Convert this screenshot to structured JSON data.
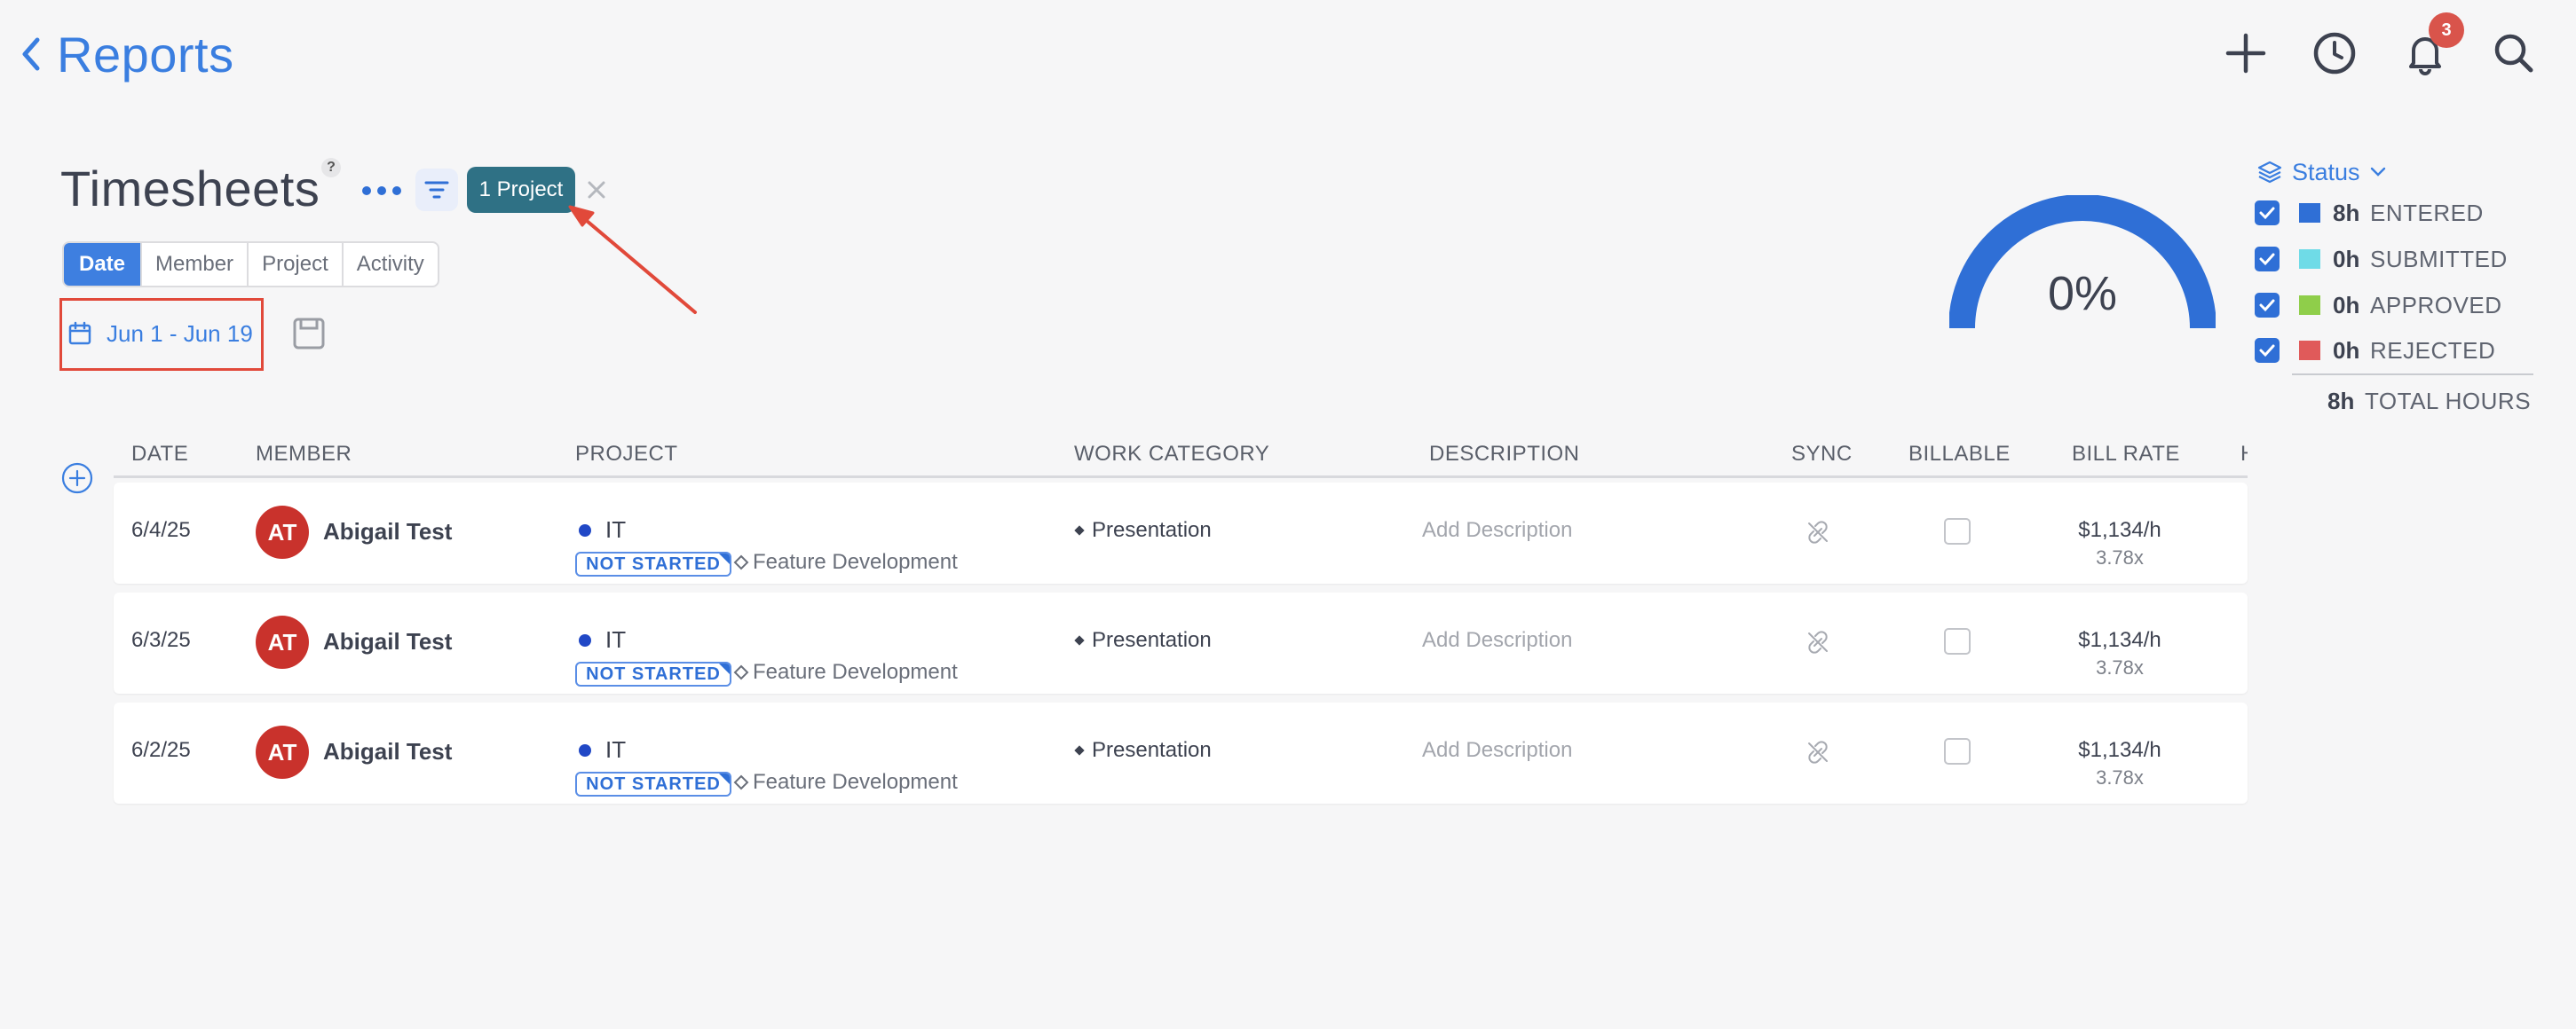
{
  "header": {
    "back_label": "Reports",
    "notification_count": "3",
    "icons": [
      "add-icon",
      "clock-icon",
      "bell-icon",
      "search-icon"
    ]
  },
  "page": {
    "title": "Timesheets",
    "help": "?",
    "filter_chip": "1 Project",
    "tabs": [
      "Date",
      "Member",
      "Project",
      "Activity"
    ],
    "active_tab": "Date",
    "date_range": "Jun 1 - Jun 19"
  },
  "summary": {
    "gauge_percent_label": "0%",
    "gauge_value": 0,
    "status_label": "Status",
    "legend": [
      {
        "hours": "8h",
        "label": "ENTERED",
        "color": "#2f6fd6",
        "checked": true
      },
      {
        "hours": "0h",
        "label": "SUBMITTED",
        "color": "#6fdbe7",
        "checked": true
      },
      {
        "hours": "0h",
        "label": "APPROVED",
        "color": "#8fce4a",
        "checked": true
      },
      {
        "hours": "0h",
        "label": "REJECTED",
        "color": "#e05a5a",
        "checked": true
      }
    ],
    "total_hours": "8h",
    "total_label": "TOTAL HOURS"
  },
  "table": {
    "columns": [
      "DATE",
      "MEMBER",
      "PROJECT",
      "WORK CATEGORY",
      "DESCRIPTION",
      "SYNC",
      "BILLABLE",
      "BILL RATE",
      "H"
    ],
    "rows": [
      {
        "date": "6/4/25",
        "initials": "AT",
        "member": "Abigail Test",
        "project": "IT",
        "status": "NOT STARTED",
        "feature": "Feature Development",
        "category": "Presentation",
        "description": "Add Description",
        "rate": "$1,134/h",
        "multiplier": "3.78x",
        "billable": false
      },
      {
        "date": "6/3/25",
        "initials": "AT",
        "member": "Abigail Test",
        "project": "IT",
        "status": "NOT STARTED",
        "feature": "Feature Development",
        "category": "Presentation",
        "description": "Add Description",
        "rate": "$1,134/h",
        "multiplier": "3.78x",
        "billable": false
      },
      {
        "date": "6/2/25",
        "initials": "AT",
        "member": "Abigail Test",
        "project": "IT",
        "status": "NOT STARTED",
        "feature": "Feature Development",
        "category": "Presentation",
        "description": "Add Description",
        "rate": "$1,134/h",
        "multiplier": "3.78x",
        "billable": false
      }
    ]
  },
  "colors": {
    "accent": "#3e7fe0",
    "chip": "#2f7185",
    "avatar": "#c9322c",
    "annotation": "#e1493a",
    "gauge": "#2f6fd6"
  }
}
